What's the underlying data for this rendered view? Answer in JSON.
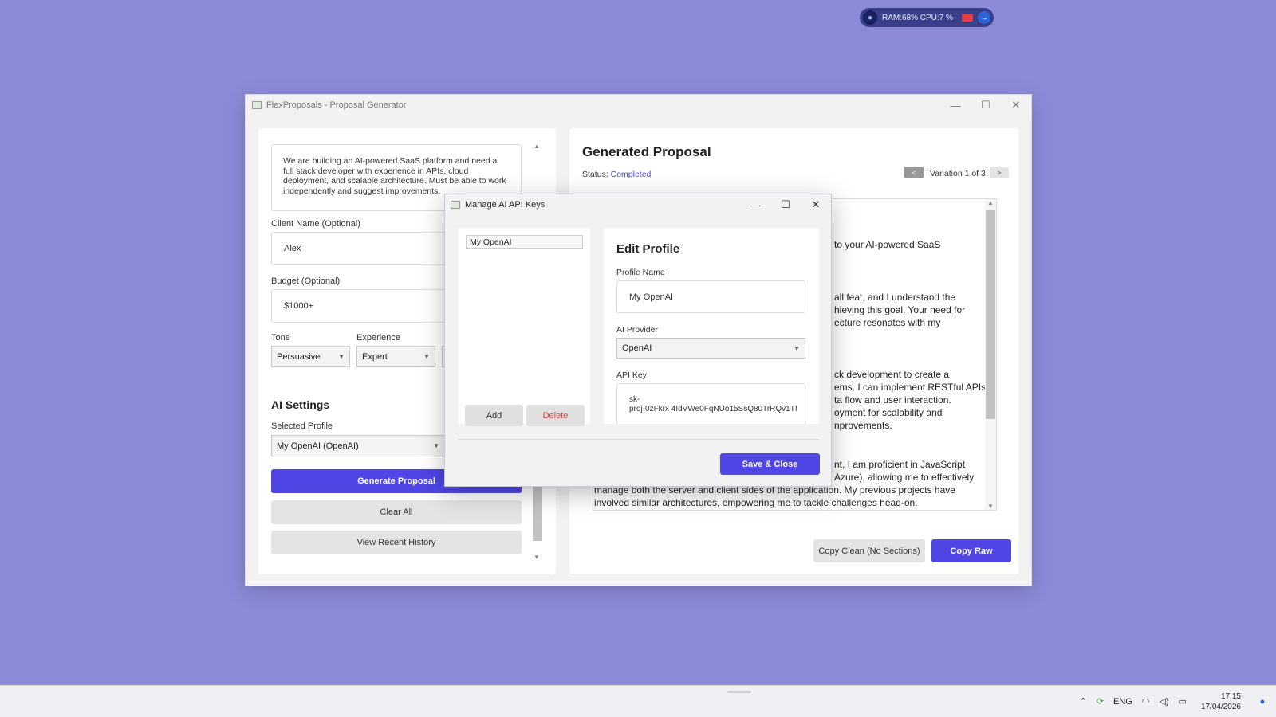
{
  "system_widget": {
    "stats": "RAM:68%  CPU:7 %"
  },
  "main_window": {
    "title": "FlexProposals - Proposal Generator",
    "left": {
      "description": "We are building an AI-powered SaaS platform and need a full stack developer with experience in APIs, cloud deployment, and scalable architecture. Must be able to work independently and suggest improvements.",
      "client_label": "Client Name (Optional)",
      "client_value": "Alex",
      "budget_label": "Budget (Optional)",
      "budget_value": "$1000+",
      "tone_label": "Tone",
      "tone_value": "Persuasive",
      "experience_label": "Experience",
      "experience_value": "Expert",
      "ai_settings_title": "AI Settings",
      "profile_label": "Selected Profile",
      "profile_value": "My OpenAI (OpenAI)",
      "generate_label": "Generate Proposal",
      "clear_label": "Clear All",
      "history_label": "View Recent History"
    },
    "right": {
      "title": "Generated Proposal",
      "status_label": "Status:",
      "status_value": "Completed",
      "prev": "<",
      "variation": "Variation 1 of 3",
      "next": ">",
      "proposal_lines": [
        "to your AI-powered SaaS",
        "all feat, and I understand the",
        "hieving this goal. Your need for",
        "ecture resonates with my",
        "ck development to create a",
        "ems. I can implement RESTful APIs",
        "ta flow and user interaction.",
        "oyment for scalability and",
        "nprovements.",
        "nt, I am proficient in JavaScript",
        "Azure), allowing me to effectively",
        "manage both the server and client sides of the application. My previous projects have",
        "involved similar architectures, empowering me to tackle challenges head-on."
      ],
      "copy_clean_label": "Copy Clean (No Sections)",
      "copy_raw_label": "Copy Raw"
    }
  },
  "dialog": {
    "title": "Manage AI API Keys",
    "profiles": [
      "My OpenAI"
    ],
    "add_label": "Add",
    "delete_label": "Delete",
    "edit_title": "Edit Profile",
    "profile_name_label": "Profile Name",
    "profile_name_value": "My OpenAI",
    "provider_label": "AI Provider",
    "provider_value": "OpenAI",
    "api_key_label": "API Key",
    "api_key_line1": "sk-",
    "api_key_line2": "proj-0zFkrx 4IdVWe0FqNUo15SsQ80TrRQv1TI",
    "save_label": "Save & Close"
  },
  "taskbar": {
    "language": "ENG",
    "time": "17:15",
    "date": "17/04/2026"
  },
  "colors": {
    "accent": "#4f46e5",
    "background": "#8b8ad8",
    "delete": "#d94040"
  }
}
